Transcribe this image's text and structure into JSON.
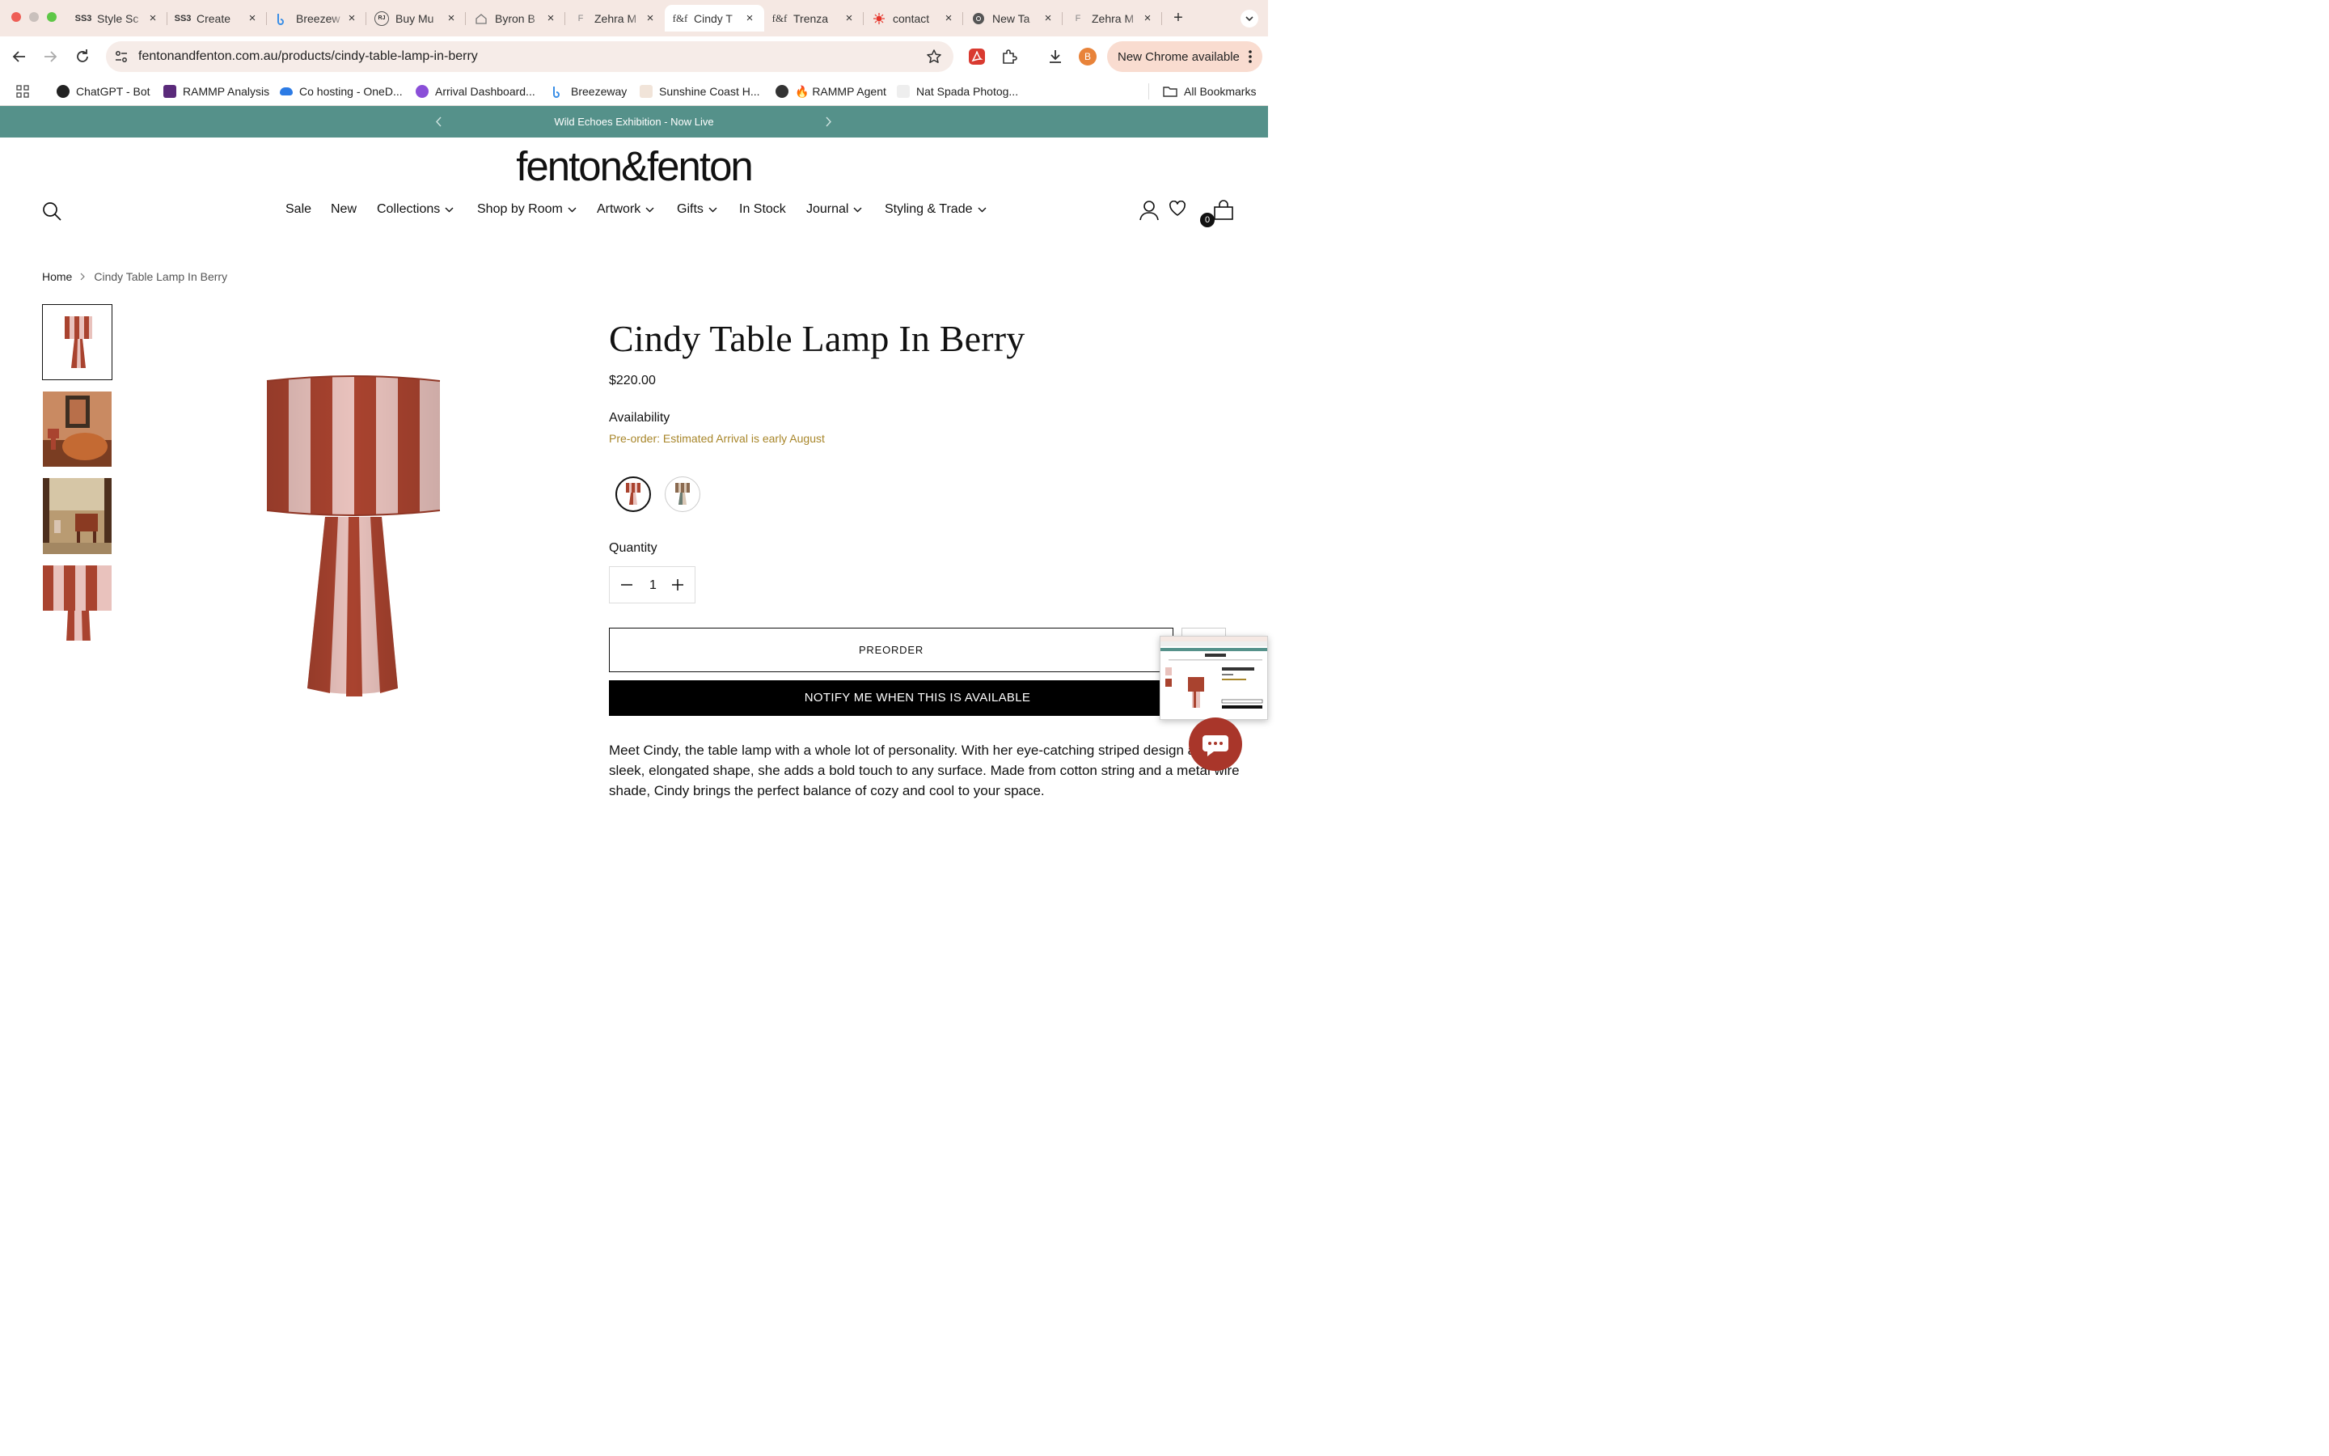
{
  "browser": {
    "tabs": [
      {
        "title": "Style Sc",
        "favicon": "ss3-icon",
        "active": false
      },
      {
        "title": "Create",
        "favicon": "ss3-icon",
        "active": false
      },
      {
        "title": "Breezew",
        "favicon": "breezeway-icon",
        "active": false
      },
      {
        "title": "Buy Mu",
        "favicon": "rj-icon",
        "active": false
      },
      {
        "title": "Byron B",
        "favicon": "house-icon",
        "active": false
      },
      {
        "title": "Zehra M",
        "favicon": "f-icon",
        "active": false
      },
      {
        "title": "Cindy T",
        "favicon": "ff-icon",
        "active": true
      },
      {
        "title": "Trenza",
        "favicon": "ff-icon",
        "active": false
      },
      {
        "title": "contact",
        "favicon": "burst-icon",
        "active": false
      },
      {
        "title": "New Ta",
        "favicon": "chrome-icon",
        "active": false
      },
      {
        "title": "Zehra M",
        "favicon": "f-icon",
        "active": false
      }
    ],
    "favicon_text": {
      "ss3": "SS3",
      "ff": "f&f",
      "rj": "RJ",
      "f": "F"
    },
    "url": "fentonandfenton.com.au/products/cindy-table-lamp-in-berry",
    "profile_initial": "B",
    "update_label": "New Chrome available",
    "bookmarks": [
      {
        "label": "ChatGPT - Bot",
        "icon": "chatgpt-icon"
      },
      {
        "label": "RAMMP Analysis",
        "icon": "rammp-icon"
      },
      {
        "label": "Co hosting - OneD...",
        "icon": "onedrive-icon"
      },
      {
        "label": "Arrival Dashboard...",
        "icon": "arrival-icon"
      },
      {
        "label": "Breezeway",
        "icon": "breezeway-icon"
      },
      {
        "label": "Sunshine Coast H...",
        "icon": "sunshine-icon"
      },
      {
        "label": "🔥 RAMMP Agent",
        "icon": "globe-icon"
      },
      {
        "label": "Nat Spada Photog...",
        "icon": "photo-icon"
      }
    ],
    "all_bookmarks_label": "All Bookmarks"
  },
  "site": {
    "announcement": "Wild Echoes Exhibition - Now Live",
    "logo": "fenton&fenton",
    "nav": [
      {
        "label": "Sale",
        "dropdown": false
      },
      {
        "label": "New",
        "dropdown": false
      },
      {
        "label": "Collections",
        "dropdown": true
      },
      {
        "label": "Shop by Room",
        "dropdown": true
      },
      {
        "label": "Artwork",
        "dropdown": true
      },
      {
        "label": "Gifts",
        "dropdown": true
      },
      {
        "label": "In Stock",
        "dropdown": false
      },
      {
        "label": "Journal",
        "dropdown": true
      },
      {
        "label": "Styling & Trade",
        "dropdown": true
      }
    ],
    "cart_count": "0"
  },
  "product": {
    "breadcrumb": [
      "Home",
      "Cindy Table Lamp In Berry"
    ],
    "title": "Cindy Table Lamp In Berry",
    "price": "$220.00",
    "availability_label": "Availability",
    "availability_value": "Pre-order: Estimated Arrival is early August",
    "quantity_label": "Quantity",
    "quantity": "1",
    "preorder_label": "PREORDER",
    "notify_label": "NOTIFY ME WHEN THIS IS AVAILABLE",
    "description": "Meet Cindy, the table lamp with a whole lot of personality. With her eye-catching striped design and sleek, elongated shape, she adds a bold touch to any surface. Made from cotton string and a metal wire shade, Cindy brings the perfect balance of cozy and cool to your space.",
    "colors": {
      "berry": "#a9432f",
      "blush": "#e9c2bd",
      "accent": "#55918a",
      "preorder_text": "#a8862a",
      "chat": "#a9362a"
    }
  }
}
